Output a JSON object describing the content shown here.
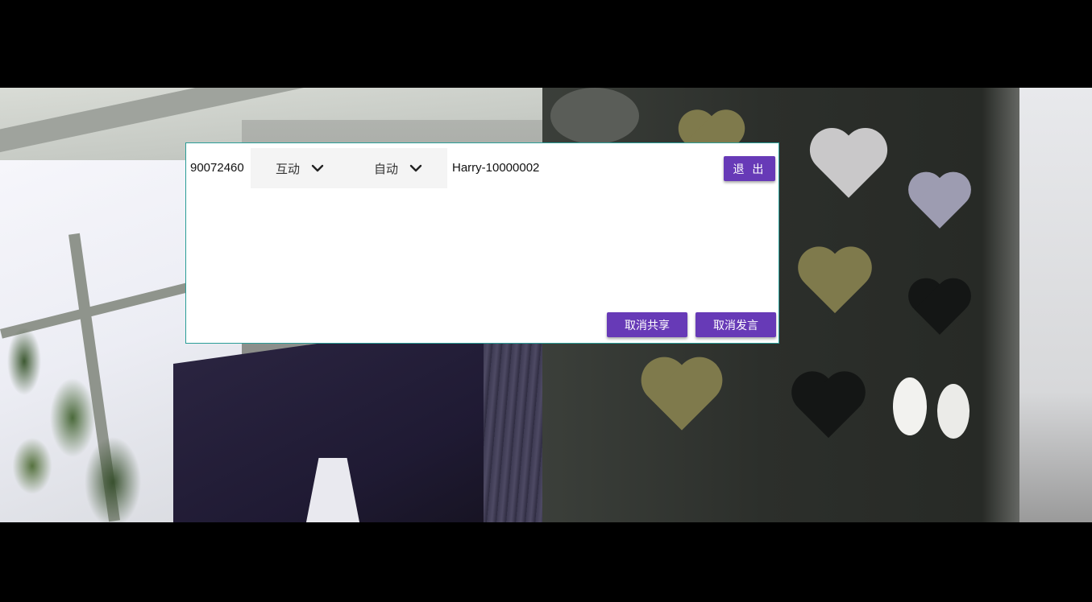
{
  "panel": {
    "meeting_id": "90072460",
    "mode_select": {
      "value": "互动",
      "icon": "chevron-down-icon"
    },
    "quality_select": {
      "value": "自动",
      "icon": "chevron-down-icon"
    },
    "user_name": "Harry-10000002",
    "exit_label": "退 出",
    "unshare_label": "取消共享",
    "unspeak_label": "取消发言"
  },
  "colors": {
    "accent": "#673ab7",
    "panel_border": "#2a9d97",
    "select_bg": "#f4f4f4"
  }
}
